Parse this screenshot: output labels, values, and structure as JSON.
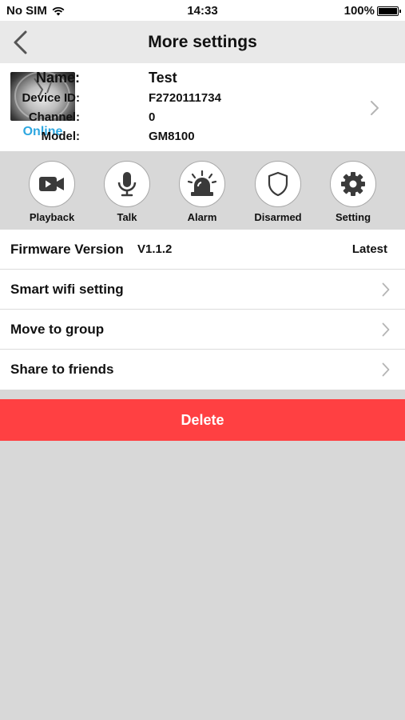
{
  "status_bar": {
    "carrier": "No SIM",
    "time": "14:33",
    "battery": "100%",
    "battery_level": 1.0
  },
  "nav": {
    "title": "More settings",
    "back_icon": "back-chevron-icon"
  },
  "device": {
    "status": "Online",
    "status_color": "#2ea7e0",
    "fields": [
      {
        "label": "Name:",
        "value": "Test"
      },
      {
        "label": "Device ID:",
        "value": "F2720111734"
      },
      {
        "label": "Channel:",
        "value": "0"
      },
      {
        "label": "Model:",
        "value": "GM8100"
      }
    ]
  },
  "actions": [
    {
      "label": "Playback",
      "icon": "video-camera-icon"
    },
    {
      "label": "Talk",
      "icon": "microphone-icon"
    },
    {
      "label": "Alarm",
      "icon": "siren-icon"
    },
    {
      "label": "Disarmed",
      "icon": "shield-icon"
    },
    {
      "label": "Setting",
      "icon": "gear-icon"
    }
  ],
  "firmware": {
    "label": "Firmware Version",
    "version": "V1.1.2",
    "status": "Latest"
  },
  "menu": [
    {
      "label": "Smart wifi setting"
    },
    {
      "label": "Move to group"
    },
    {
      "label": "Share to friends"
    }
  ],
  "delete_label": "Delete",
  "colors": {
    "accent_delete": "#ff4042",
    "online": "#2ea7e0",
    "background": "#d8d8d8"
  }
}
